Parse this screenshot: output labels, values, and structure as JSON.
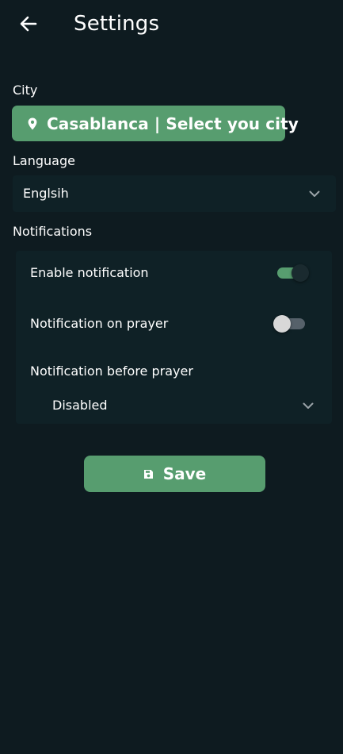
{
  "header": {
    "title": "Settings"
  },
  "city": {
    "section_label": "City",
    "button_label": "Casablanca |  Select you city"
  },
  "language": {
    "section_label": "Language",
    "selected": "Englsih"
  },
  "notifications": {
    "section_label": "Notifications",
    "enable_label": "Enable notification",
    "enable_on": true,
    "on_prayer_label": "Notification on prayer",
    "on_prayer_on": false,
    "before_prayer_label": "Notification before prayer",
    "before_prayer_selected": "Disabled"
  },
  "actions": {
    "save_label": "Save"
  },
  "colors": {
    "background": "#0e1b20",
    "card": "#0f2126",
    "accent": "#579d6f"
  },
  "icons": {
    "back": "arrow-left-icon",
    "city": "location-pin-icon",
    "dropdown": "chevron-down-icon",
    "save": "floppy-disk-icon"
  }
}
